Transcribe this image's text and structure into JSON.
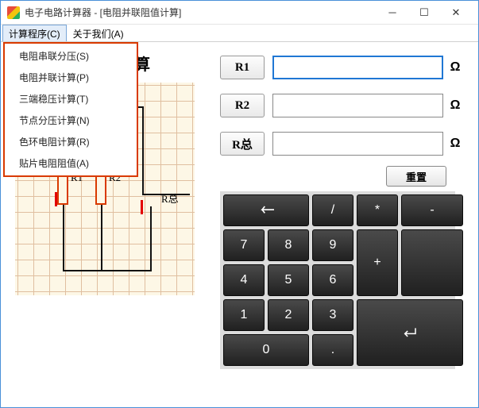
{
  "window": {
    "title": "电子电路计算器 - [电阻并联阻值计算]"
  },
  "menubar": {
    "calc": "计算程序(C)",
    "about": "关于我们(A)"
  },
  "dropdown": {
    "items": [
      "电阻串联分压(S)",
      "电阻并联计算(P)",
      "三端稳压计算(T)",
      "节点分压计算(N)",
      "色环电阻计算(R)",
      "贴片电阻阻值(A)"
    ]
  },
  "page": {
    "title_fragment": "值计算"
  },
  "diagram": {
    "r1": "R1",
    "r2": "R2",
    "rtotal": "R总"
  },
  "fields": {
    "r1": {
      "label": "R1",
      "value": "",
      "unit": "Ω"
    },
    "r2": {
      "label": "R2",
      "value": "",
      "unit": "Ω"
    },
    "rtotal": {
      "label": "R总",
      "value": "",
      "unit": "Ω"
    }
  },
  "buttons": {
    "reset": "重置"
  },
  "keypad": {
    "backspace": "←",
    "div": "/",
    "mul": "*",
    "sub": "-",
    "add": "+",
    "k7": "7",
    "k8": "8",
    "k9": "9",
    "k4": "4",
    "k5": "5",
    "k6": "6",
    "k1": "1",
    "k2": "2",
    "k3": "3",
    "k0": "0",
    "dot": ".",
    "enter": "↵"
  }
}
